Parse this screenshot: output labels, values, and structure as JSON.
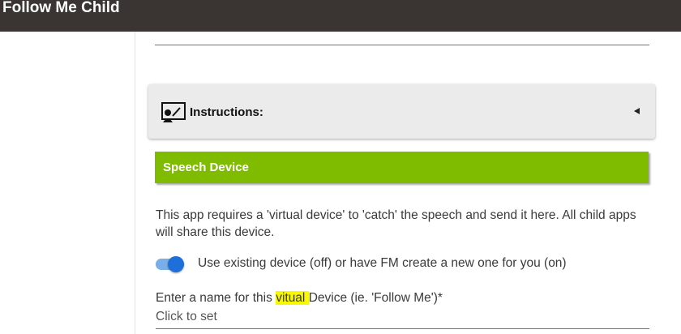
{
  "header": {
    "title": "Follow Me Child"
  },
  "instructions": {
    "label": "Instructions:",
    "icon": "presentation-board-icon",
    "expand_icon": "triangle-left-icon"
  },
  "section": {
    "title": "Speech Device",
    "color": "#7fbc00"
  },
  "description": "This app requires a 'virtual device' to 'catch' the speech and send it here. All child apps will share this device.",
  "toggle": {
    "label": "Use existing device (off) or have FM create a new one for you (on)",
    "state": "on",
    "color": "#1e6fd9"
  },
  "name_field": {
    "label_before": "Enter a name for this ",
    "label_highlight": "vitual ",
    "label_after": "Device (ie. 'Follow Me')*",
    "value": "Click to set"
  },
  "colors": {
    "topbar": "#3a3533",
    "rule": "#3b7fc4",
    "input_underline": "#d9405a",
    "highlight": "#f8f800"
  }
}
